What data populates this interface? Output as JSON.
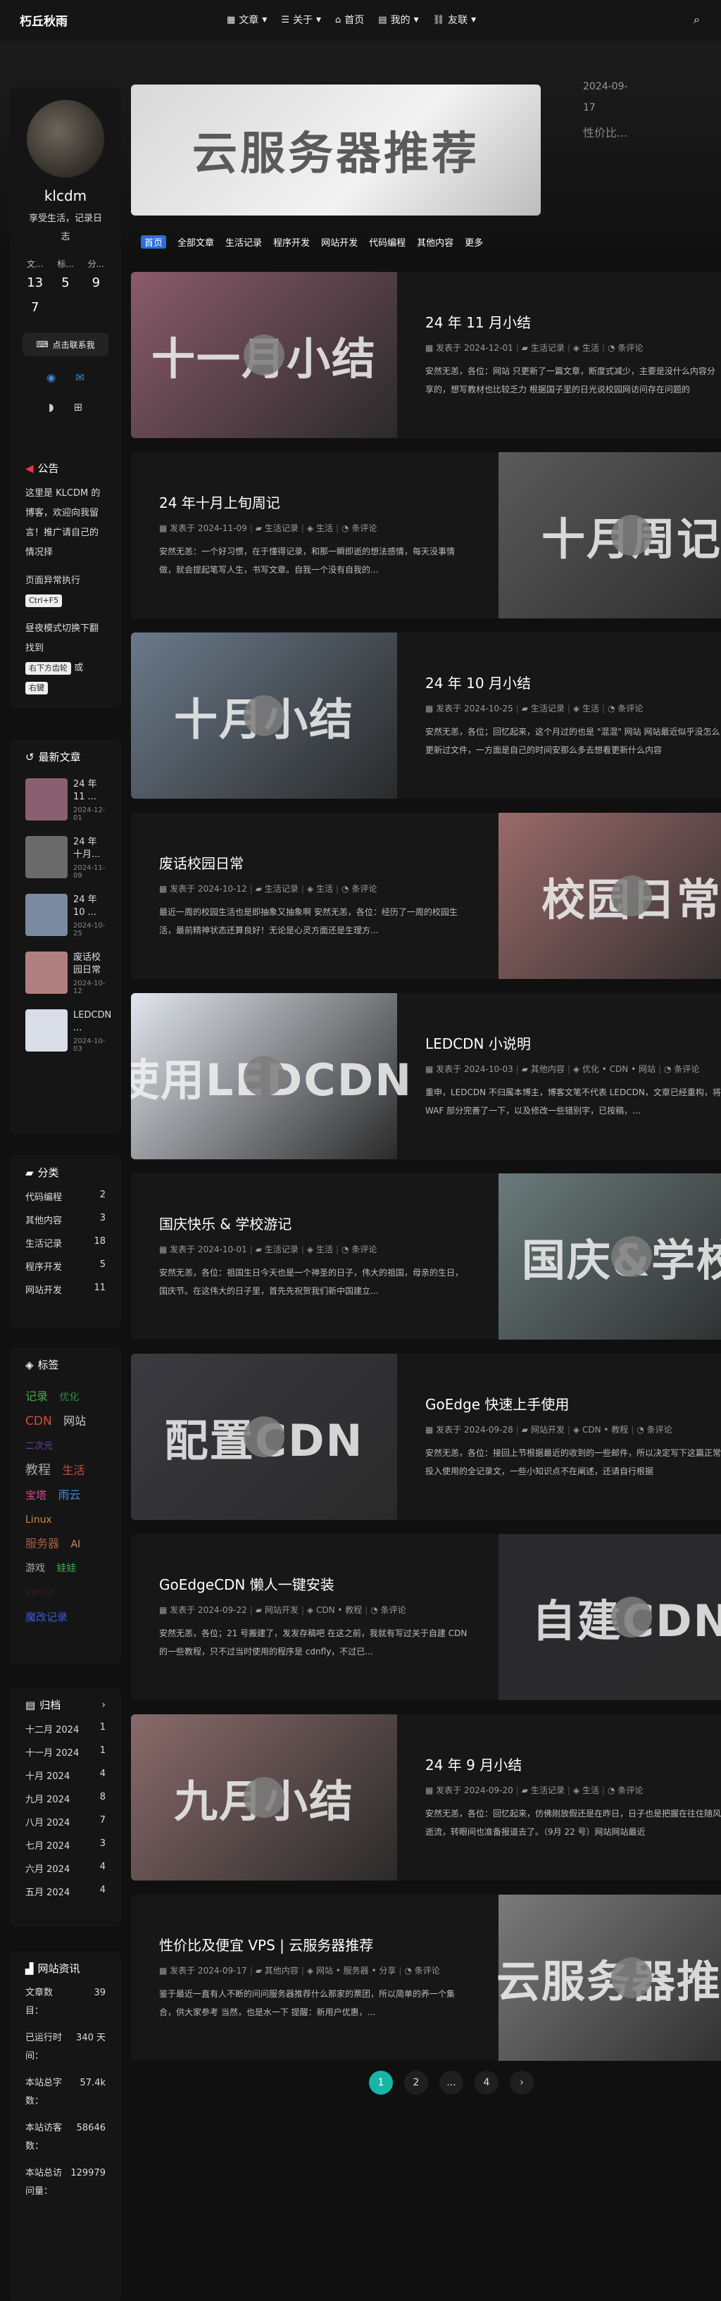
{
  "nav": {
    "brand": "朽丘秋雨",
    "items": [
      {
        "icon": "▦",
        "label": "文章",
        "caret": true
      },
      {
        "icon": "☰",
        "label": "关于",
        "caret": true
      },
      {
        "icon": "⌂",
        "label": "首页",
        "caret": false
      },
      {
        "icon": "▤",
        "label": "我的",
        "caret": true
      },
      {
        "icon": "⛓",
        "label": "友联",
        "caret": true
      }
    ]
  },
  "profile": {
    "name": "klcdm",
    "desc": "享受生活，记录日志",
    "stat_labels": [
      "文...",
      "标...",
      "分..."
    ],
    "stat_values": [
      "13",
      "5",
      "9"
    ],
    "stat_values2": [
      "7"
    ],
    "contact_label": "点击联系我"
  },
  "notice": {
    "title": "公告",
    "p1": "这里是 KLCDM 的博客，欢迎向我留言！推广请自己的情况择",
    "p2": "页面异常执行",
    "kbd1": "Ctrl+F5",
    "p3": "昼夜模式切换下翻找到",
    "kbd2": "右下方齿轮",
    "p3b": "或",
    "kbd3": "右键"
  },
  "recent": {
    "title": "最新文章",
    "items": [
      {
        "title": "24 年 11 ...",
        "date": "2024-12-01",
        "color": "#8a6070"
      },
      {
        "title": "24 年十月...",
        "date": "2024-11-09",
        "color": "#6a6a6a"
      },
      {
        "title": "24 年 10 ...",
        "date": "2024-10-25",
        "color": "#7a8aa0"
      },
      {
        "title": "废话校园日常",
        "date": "2024-10-12",
        "color": "#b08080"
      },
      {
        "title": "LEDCDN ...",
        "date": "2024-10-03",
        "color": "#d8dde8"
      }
    ]
  },
  "categories": {
    "title": "分类",
    "items": [
      {
        "name": "代码编程",
        "count": "2"
      },
      {
        "name": "其他内容",
        "count": "3"
      },
      {
        "name": "生活记录",
        "count": "18"
      },
      {
        "name": "程序开发",
        "count": "5"
      },
      {
        "name": "网站开发",
        "count": "11"
      }
    ]
  },
  "tags": {
    "title": "标签",
    "items": [
      {
        "name": "记录",
        "color": "#3cae4a"
      },
      {
        "name": "优化",
        "color": "#2f8f3f"
      },
      {
        "name": "CDN",
        "color": "#d94b3c"
      },
      {
        "name": "网站",
        "color": "#ccc"
      },
      {
        "name": "二次元",
        "color": "#6a3fb5"
      },
      {
        "name": "教程",
        "color": "#aaa"
      },
      {
        "name": "生活",
        "color": "#c74c3c"
      },
      {
        "name": "宝塔",
        "color": "#d94b8c"
      },
      {
        "name": "雨云",
        "color": "#3d8bd8"
      },
      {
        "name": "Linux",
        "color": "#c78a3c"
      },
      {
        "name": "服务器",
        "color": "#b05c3c"
      },
      {
        "name": "AI",
        "color": "#c78a6c"
      },
      {
        "name": "游戏",
        "color": "#aaa"
      },
      {
        "name": "娃娃",
        "color": "#3cae4a"
      },
      {
        "name": "Vercel",
        "color": "#3a1d1d"
      },
      {
        "name": "魔改记录",
        "color": "#3d5bd8"
      }
    ]
  },
  "archive": {
    "title": "归档",
    "items": [
      {
        "name": "十二月 2024",
        "count": "1"
      },
      {
        "name": "十一月 2024",
        "count": "1"
      },
      {
        "name": "十月 2024",
        "count": "4"
      },
      {
        "name": "九月 2024",
        "count": "8"
      },
      {
        "name": "八月 2024",
        "count": "7"
      },
      {
        "name": "七月 2024",
        "count": "3"
      },
      {
        "name": "六月 2024",
        "count": "4"
      },
      {
        "name": "五月 2024",
        "count": "4"
      }
    ]
  },
  "siteinfo": {
    "title": "网站资讯",
    "items": [
      {
        "k": "文章数目：",
        "v": "39"
      },
      {
        "k": "已运行时间：",
        "v": "340 天"
      },
      {
        "k": "本站总字数：",
        "v": "57.4k"
      },
      {
        "k": "本站访客数：",
        "v": "58646"
      },
      {
        "k": "本站总访问量：",
        "v": "129979"
      }
    ]
  },
  "hero": {
    "banner_title": "云服务器推荐",
    "date": "2024-09-17",
    "excerpt": "性价比..."
  },
  "tabs": [
    "首页",
    "全部文章",
    "生活记录",
    "程序开发",
    "网站开发",
    "代码编程",
    "其他内容",
    "更多"
  ],
  "posts": [
    {
      "title": "24 年 11 月小结",
      "cover": "十一月小结",
      "date": "2024-12-01",
      "cat": "生活记录",
      "tags": "生活",
      "comments": "条评论",
      "excerpt": "安然无恙，各位：网站 只更新了一篇文章，断度式减少，主要是没什么内容分享的，想写教材也比较乏力 根据国子里的日光说校园网访问存在问题的",
      "color": "#8a5a6a"
    },
    {
      "title": "24 年十月上旬周记",
      "cover": "十月周记",
      "date": "2024-11-09",
      "cat": "生活记录",
      "tags": "生活",
      "comments": "条评论",
      "excerpt": "安然无恙：一个好习惯，在于懂得记录，和那一瞬即逝的想法感情，每天没事情做，就会提起笔写人生，书写文章。自我一个没有自我的...",
      "color": "#5a5a5a"
    },
    {
      "title": "24 年 10 月小结",
      "cover": "十月小结",
      "date": "2024-10-25",
      "cat": "生活记录",
      "tags": "生活",
      "comments": "条评论",
      "excerpt": "安然无恙，各位；回忆起来，这个月过的也是 \"混混\" 网站 网站最近似乎没怎么更新过文件，一方面是自己的时间安那么多去想看更新什么内容",
      "color": "#6a7a8a"
    },
    {
      "title": "废话校园日常",
      "cover": "校园日常",
      "date": "2024-10-12",
      "cat": "生活记录",
      "tags": "生活",
      "comments": "条评论",
      "excerpt": "最近一周的校园生活也是即抽象又抽象啊 安然无恙，各位：经历了一周的校园生活，最前精神状态还算良好！无论是心灵方面还是生理方...",
      "color": "#9a6a6a"
    },
    {
      "title": "LEDCDN 小说明",
      "cover": "使用LEDCDN",
      "date": "2024-10-03",
      "cat": "其他内容",
      "tags": "优化 • CDN • 网站",
      "comments": "条评论",
      "excerpt": "重申，LEDCDN 不归属本博主，博客文笔不代表 LEDCDN，文章已经重构，将 WAF 部分完善了一下，以及修改一些错别字，已按稿，...",
      "color": "#e2e6ee"
    },
    {
      "title": "国庆快乐 & 学校游记",
      "cover": "国庆&学校",
      "date": "2024-10-01",
      "cat": "生活记录",
      "tags": "生活",
      "comments": "条评论",
      "excerpt": "安然无恙，各位：祖国生日今天也是一个神圣的日子，伟大的祖国，母亲的生日，国庆节。在这伟大的日子里，首先先祝贺我们新中国建立...",
      "color": "#6a7a7a"
    },
    {
      "title": "GoEdge 快速上手使用",
      "cover": "配置CDN",
      "date": "2024-09-28",
      "cat": "网站开发",
      "tags": "CDN • 教程",
      "comments": "条评论",
      "excerpt": "安然无恙，各位：接回上节根据最近的收到的一些邮件，所以决定写下这篇正常投入使用的全记录文，一些小知识点不在阐述，还请自行根据",
      "color": "#3a3a40"
    },
    {
      "title": "GoEdgeCDN 懒人一键安装",
      "cover": "自建CDN",
      "date": "2024-09-22",
      "cat": "网站开发",
      "tags": "CDN • 教程",
      "comments": "条评论",
      "excerpt": "安然无恙，各位；21 号搬建了，发发存稿吧 在这之前，我就有写过关于自建 CDN 的一些教程，只不过当时使用的程序是 cdnfly，不过已...",
      "color": "#2a2a2e"
    },
    {
      "title": "24 年 9 月小结",
      "cover": "九月小结",
      "date": "2024-09-20",
      "cat": "生活记录",
      "tags": "生活",
      "comments": "条评论",
      "excerpt": "安然无恙，各位：回忆起来，仿佛刚放假还是在昨日，日子也是把握在往住随风逝流，转眼间也准备报道去了。（9月 22 号）网站网站最近",
      "color": "#8a6a6a"
    },
    {
      "title": "性价比及便宜 VPS | 云服务器推荐",
      "cover": "云服务器推荐",
      "date": "2024-09-17",
      "cat": "其他内容",
      "tags": "网站 • 服务器 • 分享",
      "comments": "条评论",
      "excerpt": "鉴于最近一直有人不断的问问服务器推荐什么那家的票团，所以简单的养一个集合，供大家参考 当然，也是水一下 提醒：新用户优惠，...",
      "color": "#7a7a7a"
    }
  ],
  "pager": [
    "1",
    "2",
    "...",
    "4",
    "›"
  ]
}
